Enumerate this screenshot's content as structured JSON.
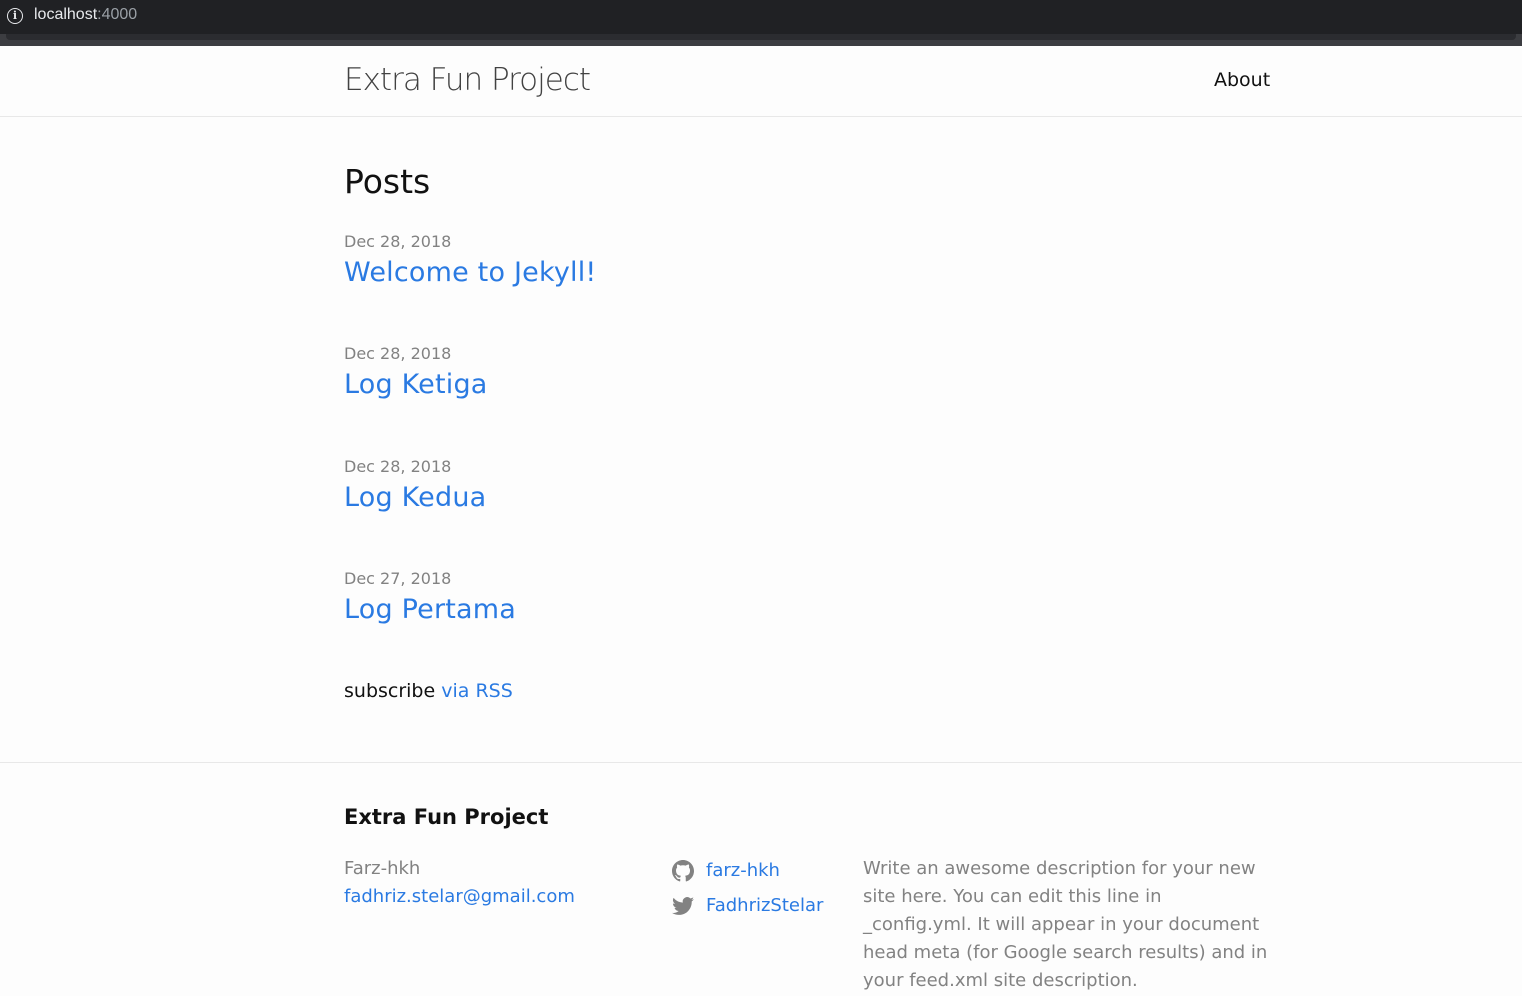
{
  "browser": {
    "host": "localhost",
    "port": ":4000"
  },
  "header": {
    "site_title": "Extra Fun Project",
    "nav_about": "About"
  },
  "main": {
    "heading": "Posts",
    "posts": [
      {
        "date": "Dec 28, 2018",
        "title": "Welcome to Jekyll!"
      },
      {
        "date": "Dec 28, 2018",
        "title": "Log Ketiga"
      },
      {
        "date": "Dec 28, 2018",
        "title": "Log Kedua"
      },
      {
        "date": "Dec 27, 2018",
        "title": "Log Pertama"
      }
    ],
    "subscribe_text": "subscribe ",
    "rss_link": "via RSS"
  },
  "footer": {
    "heading": "Extra Fun Project",
    "author": "Farz-hkh",
    "email": "fadhriz.stelar@gmail.com",
    "github_user": "farz-hkh",
    "twitter_user": "FadhrizStelar",
    "description": "Write an awesome description for your new site here. You can edit this line in _config.yml. It will appear in your document head meta (for Google search results) and in your feed.xml site description."
  },
  "icons": {
    "github": "github-icon",
    "twitter": "twitter-icon",
    "info": "info-icon"
  },
  "colors": {
    "link": "#2a7ae2",
    "meta": "#828282",
    "text": "#111111"
  }
}
